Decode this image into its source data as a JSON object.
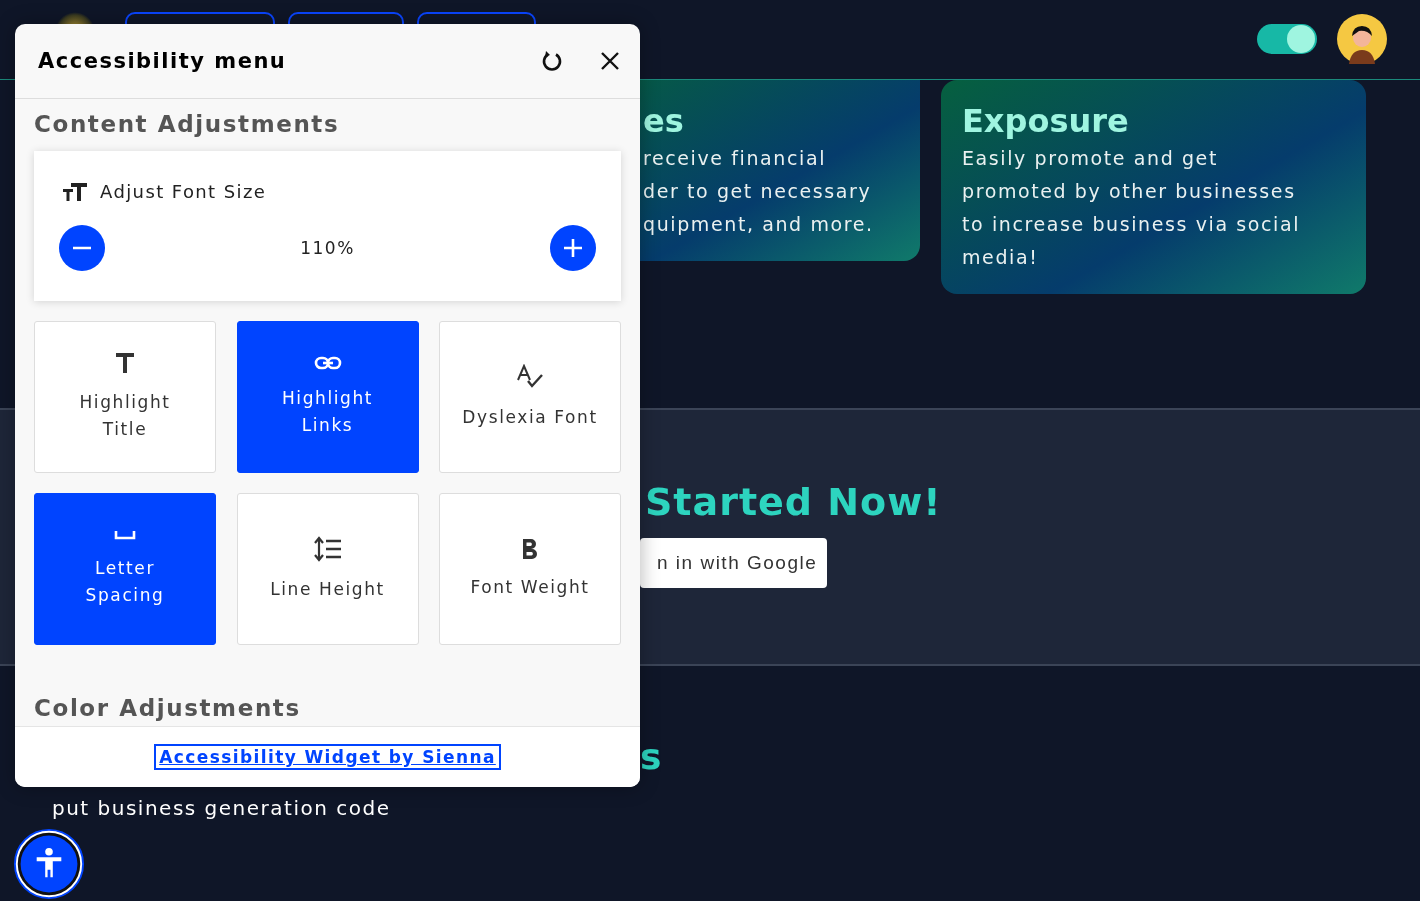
{
  "page": {
    "cards": [
      {
        "title": "es",
        "lines": [
          "receive financial",
          "der to get necessary",
          "quipment, and more."
        ]
      },
      {
        "title": "Exposure",
        "text": "Easily promote and get promoted by other businesses to increase business via social media!"
      }
    ],
    "theme_toggle": {
      "on": true
    },
    "cta": {
      "heading": "Started Now!",
      "button": "n in with Google"
    },
    "section": {
      "heading": "s",
      "text": "put business generation code"
    }
  },
  "menu": {
    "title": "Accessibility menu",
    "section": "Content Adjustments",
    "font_size": {
      "label": "Adjust Font Size",
      "value": "110%"
    },
    "tiles": [
      {
        "kind": "title",
        "label": "Highlight Title",
        "selected": false
      },
      {
        "kind": "links",
        "label": "Highlight Links",
        "selected": true
      },
      {
        "kind": "dyslexia",
        "label": "Dyslexia Font",
        "selected": false
      },
      {
        "kind": "spacing",
        "label": "Letter Spacing",
        "selected": true
      },
      {
        "kind": "lineheight",
        "label": "Line Height",
        "selected": false
      },
      {
        "kind": "weight",
        "label": "Font Weight",
        "selected": false
      }
    ],
    "next_section": "Color Adjustments",
    "footer_link": "Accessibility Widget by Sienna"
  }
}
